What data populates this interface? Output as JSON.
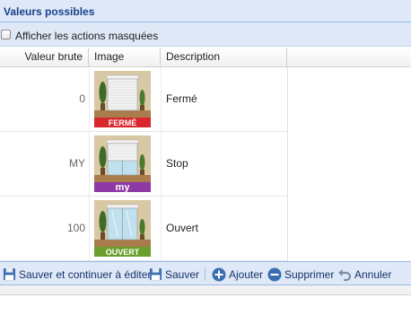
{
  "panel": {
    "title": "Valeurs possibles"
  },
  "options": {
    "show_hidden_label": "Afficher les actions masquées",
    "show_hidden_checked": false
  },
  "grid": {
    "columns": [
      "Valeur brute",
      "Image",
      "Description"
    ],
    "rows": [
      {
        "raw": "0",
        "badge": "FERMÉ",
        "badge_color": "#d9262c",
        "state": "closed",
        "description": "Fermé"
      },
      {
        "raw": "MY",
        "badge": "my",
        "badge_color": "#8e3aa5",
        "state": "stop",
        "description": "Stop"
      },
      {
        "raw": "100",
        "badge": "OUVERT",
        "badge_color": "#6a9e2c",
        "state": "open",
        "description": "Ouvert"
      }
    ]
  },
  "toolbar": {
    "save_continue": "Sauver et continuer à éditer",
    "save": "Sauver",
    "add": "Ajouter",
    "delete": "Supprimer",
    "cancel": "Annuler"
  },
  "colors": {
    "header_bg": "#dfe8f6",
    "header_text": "#15428b",
    "border": "#99bbe8"
  }
}
